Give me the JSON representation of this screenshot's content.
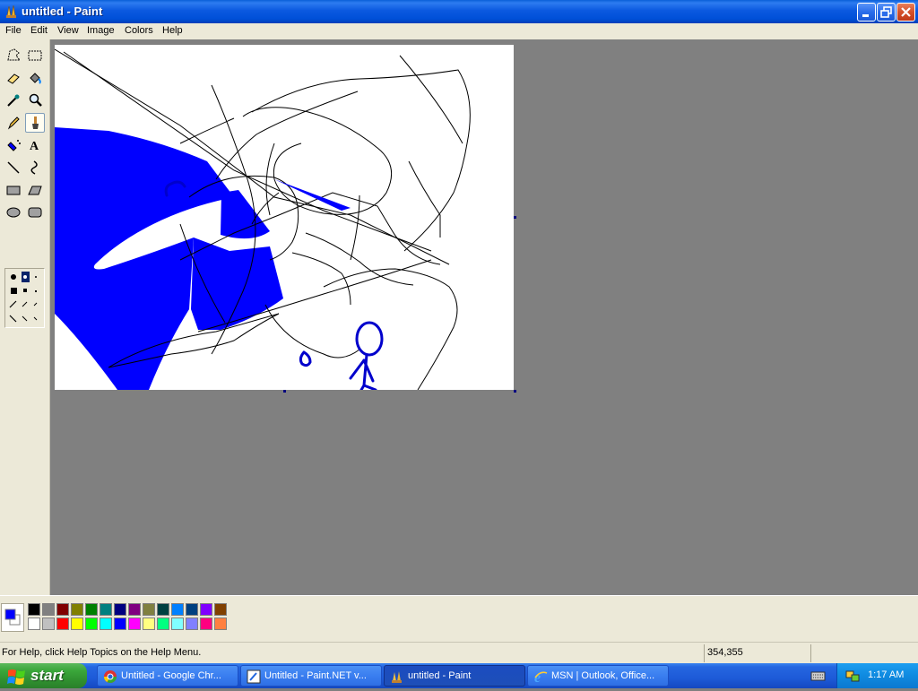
{
  "window": {
    "title": "untitled - Paint"
  },
  "menu": [
    "File",
    "Edit",
    "View",
    "Image",
    "Colors",
    "Help"
  ],
  "tools": [
    "free-form-select",
    "select",
    "eraser",
    "fill-with-color",
    "pick-color",
    "magnifier",
    "pencil",
    "brush",
    "airbrush",
    "text",
    "line",
    "curve",
    "rectangle",
    "polygon",
    "ellipse",
    "rounded-rectangle"
  ],
  "active_tool": "brush",
  "colors": {
    "foreground": "#0000ff",
    "background": "#ffffff",
    "palette_row1": [
      "#000000",
      "#808080",
      "#800000",
      "#808000",
      "#008000",
      "#008080",
      "#000080",
      "#800080",
      "#808040",
      "#004040",
      "#0080ff",
      "#004080",
      "#8000ff",
      "#804000"
    ],
    "palette_row2": [
      "#ffffff",
      "#c0c0c0",
      "#ff0000",
      "#ffff00",
      "#00ff00",
      "#00ffff",
      "#0000ff",
      "#ff00ff",
      "#ffff80",
      "#00ff80",
      "#80ffff",
      "#8080ff",
      "#ff0080",
      "#ff8040"
    ]
  },
  "status": {
    "help_text": "For Help, click Help Topics on the Help Menu.",
    "coords": "354,355"
  },
  "taskbar": {
    "start_label": "start",
    "tasks": [
      {
        "label": "Untitled - Google Chr...",
        "icon": "chrome-icon"
      },
      {
        "label": "Untitled - Paint.NET v...",
        "icon": "paintnet-icon"
      },
      {
        "label": "untitled - Paint",
        "icon": "paint-icon"
      },
      {
        "label": "MSN | Outlook, Office...",
        "icon": "ie-icon"
      }
    ],
    "clock": "1:17 AM"
  }
}
